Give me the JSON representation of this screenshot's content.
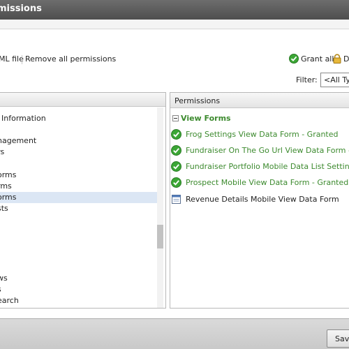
{
  "window": {
    "title": "missions"
  },
  "toolbar": {
    "export_link": "ML file",
    "remove_all": "Remove all permissions",
    "grant_all": "Grant all",
    "deny_all": "D"
  },
  "filter": {
    "label": "Filter:",
    "value": "<All Typ"
  },
  "left_panel": {
    "items": [
      {
        "label": "Information",
        "indent": 6,
        "selected": false
      },
      {
        "label": "nagement",
        "indent": 0,
        "selected": false
      },
      {
        "label": "rs",
        "indent": 0,
        "selected": false
      },
      {
        "label": "orms",
        "indent": 0,
        "selected": false
      },
      {
        "label": "rms",
        "indent": 0,
        "selected": false
      },
      {
        "label": "orms",
        "indent": 0,
        "selected": true
      },
      {
        "label": "sts",
        "indent": 0,
        "selected": false
      },
      {
        "label": "ws",
        "indent": 0,
        "selected": false
      },
      {
        "label": "s",
        "indent": 0,
        "selected": false
      },
      {
        "label": "earch",
        "indent": 0,
        "selected": false
      }
    ]
  },
  "permissions": {
    "header": "Permissions",
    "group": "View Forms",
    "items": [
      {
        "label": "Frog Settings View Data Form - Granted",
        "status": "granted"
      },
      {
        "label": "Fundraiser On The Go Url View Data Form - Granted",
        "status": "granted"
      },
      {
        "label": "Fundraiser Portfolio Mobile Data List Settings View Data Form - Granted",
        "status": "granted"
      },
      {
        "label": "Prospect Mobile View Data Form - Granted",
        "status": "granted"
      },
      {
        "label": "Revenue Details Mobile View Data Form",
        "status": "none"
      }
    ]
  },
  "footer": {
    "save_label": "Save"
  },
  "colors": {
    "granted": "#3c8a2e",
    "selection": "#dbe6f4",
    "titlebar": "#5a5a5a"
  }
}
